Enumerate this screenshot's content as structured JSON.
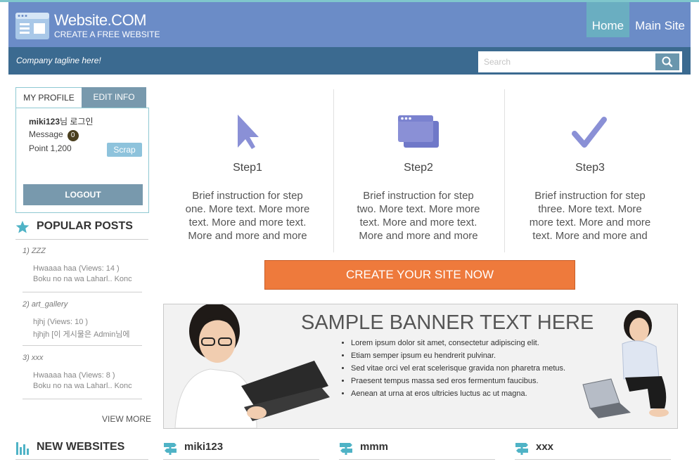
{
  "header": {
    "logo_title": "Website.COM",
    "logo_subtitle": "CREATE A FREE WEBSITE",
    "nav": [
      {
        "label": "Home",
        "active": true
      },
      {
        "label": "Main Site",
        "active": false
      }
    ]
  },
  "subbar": {
    "tagline": "Company tagline here!",
    "search_placeholder": "Search"
  },
  "profile": {
    "tabs": [
      "MY PROFILE",
      "EDIT INFO"
    ],
    "username": "miki123",
    "username_suffix": "님 로그인",
    "message_label": "Message",
    "message_count": "0",
    "point_label": "Point 1,200",
    "scrap_label": "Scrap",
    "logout_label": "LOGOUT"
  },
  "popular_posts": {
    "title": "POPULAR POSTS",
    "groups": [
      {
        "category": "1) ZZZ",
        "lines": [
          "Hwaaaa haa (Views: 14 )",
          "Boku no na wa Laharl.. Konc"
        ]
      },
      {
        "category": "2) art_gallery",
        "lines": [
          "hjhj (Views: 10 )",
          "hjhjh [이 게시물은 Admin님에"
        ]
      },
      {
        "category": "3) xxx",
        "lines": [
          "Hwaaaa haa (Views: 8 )",
          "Boku no na wa Laharl.. Konc"
        ]
      }
    ],
    "view_more": "VIEW MORE"
  },
  "steps": [
    {
      "icon": "cursor-icon",
      "title": "Step1",
      "text": "Brief instruction for step one. More text. More more text. More and more text. More and more and more"
    },
    {
      "icon": "windows-icon",
      "title": "Step2",
      "text": "Brief instruction for step two. More text. More more text. More and more text. More and more and more"
    },
    {
      "icon": "checkmark-icon",
      "title": "Step3",
      "text": "Brief instruction for step three. More text. More more text. More and more text. More and more and"
    }
  ],
  "cta_label": "CREATE YOUR SITE NOW",
  "banner": {
    "title": "SAMPLE BANNER TEXT HERE",
    "bullets": [
      "Lorem ipsum dolor sit amet, consectetur adipiscing elit.",
      "Etiam semper ipsum eu hendrerit pulvinar.",
      "Sed vitae orci vel erat scelerisque gravida non pharetra metus.",
      "Praesent tempus massa sed eros fermentum faucibus.",
      "Aenean at urna at eros ultricies luctus ac ut magna."
    ]
  },
  "new_websites": {
    "title": "NEW WEBSITES",
    "items": [
      "miki123",
      "mmm",
      "xxx"
    ]
  },
  "colors": {
    "header": "#6b8cc7",
    "subbar": "#3b6a90",
    "accent_teal": "#6aaec1",
    "cta": "#ee7a3c",
    "step_icon": "#8a90d6"
  }
}
